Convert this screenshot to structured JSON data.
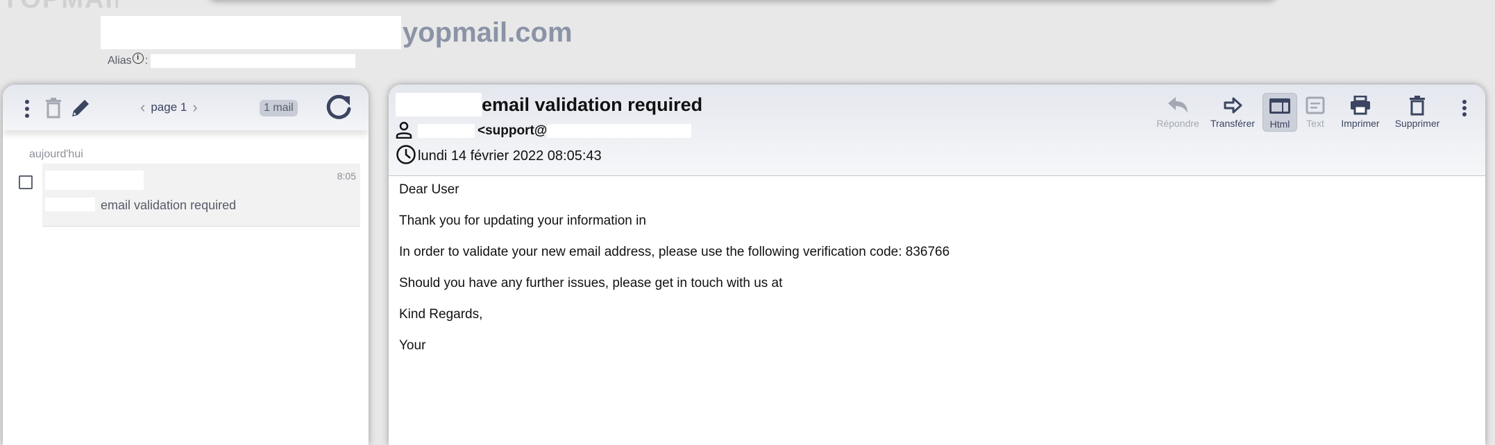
{
  "header": {
    "address_domain": "yopmail.com",
    "alias_label": "Alias",
    "alias_separator": ":"
  },
  "inbox": {
    "pagination_label": "page 1",
    "prev_glyph": "‹",
    "next_glyph": "›",
    "mail_count": "1 mail",
    "group_label": "aujourd'hui",
    "items": [
      {
        "time": "8:05",
        "subject": "email validation required"
      }
    ]
  },
  "message": {
    "subject": "email validation required",
    "from_email_prefix": "<support@",
    "date": "lundi 14 février 2022 08:05:43",
    "actions": {
      "reply": "Répondre",
      "forward": "Transférer",
      "html": "Html",
      "text": "Text",
      "print": "Imprimer",
      "delete": "Supprimer"
    },
    "body": [
      "Dear User",
      "Thank you for updating your information in",
      "In order to validate your new email address, please use the following verification code: 836766",
      "Should you have any further issues, please get in touch with us at",
      "Kind Regards,",
      "Your"
    ]
  },
  "colors": {
    "page_background": "#e8e8e8",
    "toolbar_gradient_top": "#e4e7ee",
    "icon_primary": "#3b4460",
    "icon_disabled": "#a4a8b3",
    "domain_text": "#8b93a6"
  },
  "icons": {
    "inbox_toolbar": [
      "more-vertical-icon",
      "trash-icon",
      "pencil-icon",
      "chevron-left-icon",
      "chevron-right-icon",
      "refresh-icon"
    ],
    "message_header": [
      "person-icon",
      "clock-icon"
    ],
    "message_actions": [
      "reply-icon",
      "forward-icon",
      "html-view-icon",
      "text-view-icon",
      "printer-icon",
      "trash-icon",
      "more-vertical-icon"
    ]
  }
}
